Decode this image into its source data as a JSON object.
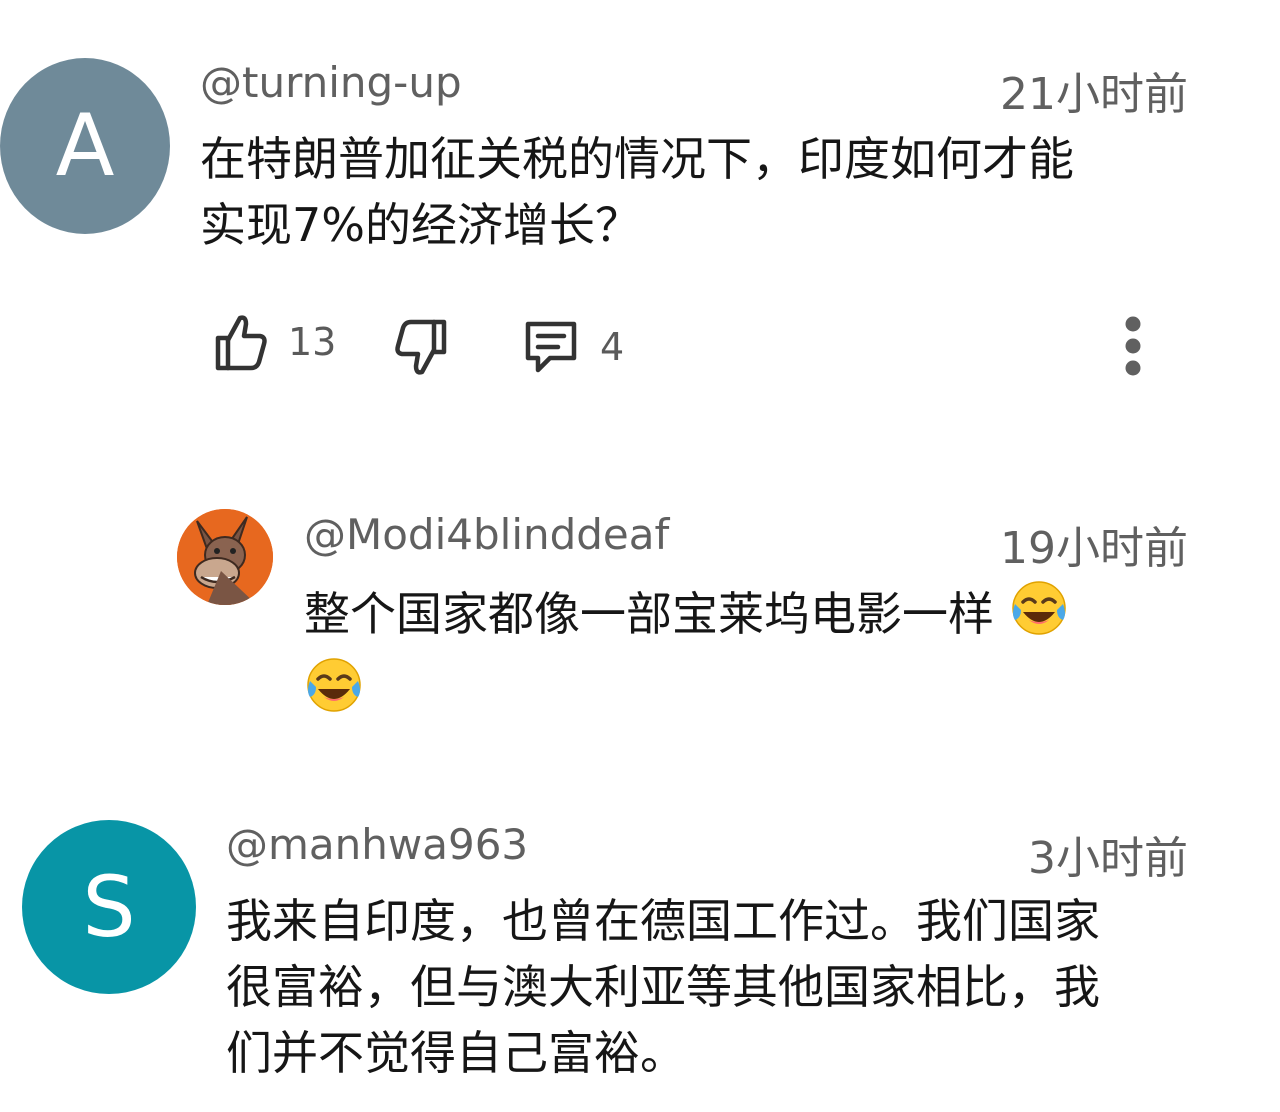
{
  "comments": [
    {
      "avatar_letter": "A",
      "avatar_color": "#6f8a99",
      "handle": "@turning-up",
      "time": "21小时前",
      "text_line1": "在特朗普加征关税的情况下，印度如何才能",
      "text_line2": "实现7%的经济增长？",
      "likes": "13",
      "replies": "4"
    },
    {
      "avatar_icon": "donkey-avatar",
      "handle": "@Modi4blinddeaf",
      "time": "19小时前",
      "text": "整个国家都像一部宝莱坞电影一样"
    },
    {
      "avatar_letter": "S",
      "avatar_color": "#0895a6",
      "handle": "@manhwa963",
      "time": "3小时前",
      "text_line1": "我来自印度，也曾在德国工作过。我们国家",
      "text_line2": "很富裕，但与澳大利亚等其他国家相比，我",
      "text_line3": "们并不觉得自己富裕。"
    }
  ],
  "icons": {
    "like": "thumbs-up-icon",
    "dislike": "thumbs-down-icon",
    "reply": "comment-icon",
    "more": "more-vertical-icon",
    "emoji": "face-with-tears-of-joy-icon"
  }
}
